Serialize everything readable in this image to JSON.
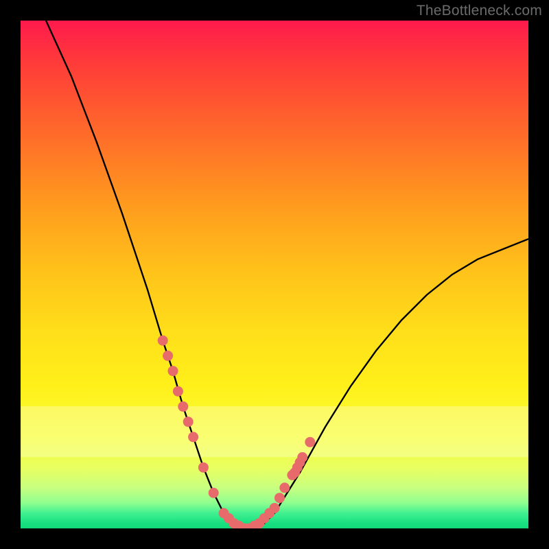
{
  "watermark": {
    "text": "TheBottleneck.com"
  },
  "colors": {
    "background": "#000000",
    "curve": "#000000",
    "marker": "#e76b6b",
    "gradient_top": "#ff1a4d",
    "gradient_bottom": "#13d878"
  },
  "chart_data": {
    "type": "line",
    "title": "",
    "xlabel": "",
    "ylabel": "",
    "xlim": [
      0,
      100
    ],
    "ylim": [
      0,
      100
    ],
    "grid": false,
    "note": "Values in percent; y is bottleneck severity. Curve estimated from pixel positions (no axis ticks present).",
    "series": [
      {
        "name": "bottleneck-curve",
        "x": [
          5,
          10,
          15,
          20,
          25,
          28,
          30,
          32,
          34,
          36,
          38,
          40,
          42,
          44,
          46,
          48,
          50,
          55,
          60,
          65,
          70,
          75,
          80,
          85,
          90,
          95,
          100
        ],
        "y": [
          100,
          89,
          76,
          62,
          47,
          37,
          31,
          24,
          18,
          12,
          7,
          3,
          1,
          0,
          0,
          1,
          3,
          11,
          20,
          28,
          35,
          41,
          46,
          50,
          53,
          55,
          57
        ]
      }
    ],
    "markers": {
      "name": "highlighted-points",
      "color": "#e76b6b",
      "x": [
        28,
        29,
        30,
        31,
        32,
        33,
        34,
        36,
        38,
        40,
        41,
        42,
        43,
        44,
        45,
        46,
        47,
        48,
        49,
        50,
        51,
        52,
        53.5,
        54,
        54.5,
        55,
        55.5,
        57
      ],
      "y": [
        37,
        34,
        31,
        27,
        24,
        21,
        18,
        12,
        7,
        3,
        2,
        1,
        0.5,
        0,
        0,
        0.5,
        1,
        2,
        3,
        4,
        6,
        8,
        10.5,
        11,
        12,
        13,
        14,
        17
      ]
    },
    "pale_band": {
      "y_from": 14,
      "y_to": 24
    }
  }
}
